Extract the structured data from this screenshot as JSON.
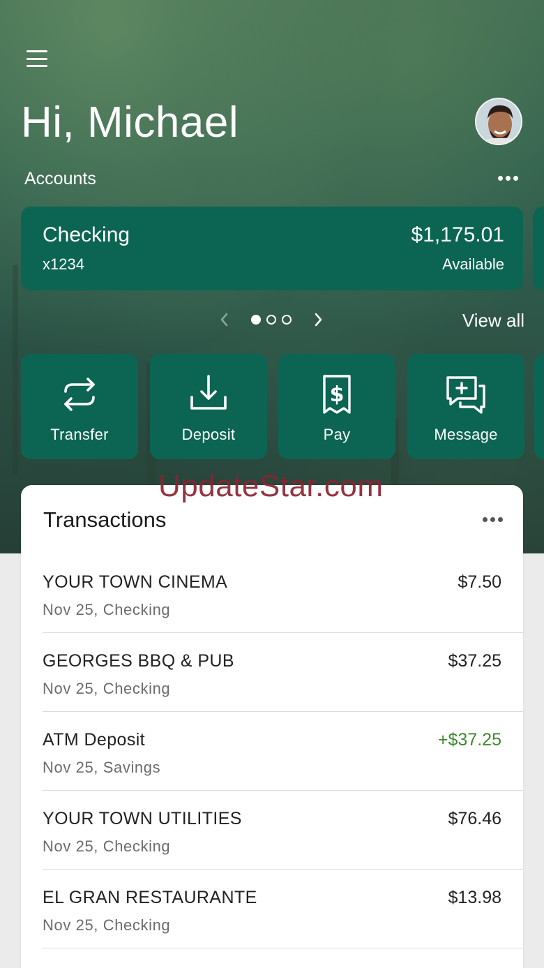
{
  "header": {
    "greeting": "Hi, Michael",
    "accounts_label": "Accounts"
  },
  "account": {
    "name": "Checking",
    "number": "x1234",
    "balance": "$1,175.01",
    "balance_label": "Available"
  },
  "carousel": {
    "page_count": 3,
    "active_page": 1,
    "view_all": "View all"
  },
  "actions": [
    {
      "label": "Transfer",
      "icon": "transfer-icon"
    },
    {
      "label": "Deposit",
      "icon": "deposit-icon"
    },
    {
      "label": "Pay",
      "icon": "pay-icon"
    },
    {
      "label": "Message",
      "icon": "message-icon"
    }
  ],
  "watermark": "UpdateStar.com",
  "transactions": {
    "title": "Transactions",
    "items": [
      {
        "name": "YOUR TOWN CINEMA",
        "sub": "Nov 25, Checking",
        "amount": "$7.50",
        "credit": false
      },
      {
        "name": "GEORGES BBQ & PUB",
        "sub": "Nov 25, Checking",
        "amount": "$37.25",
        "credit": false
      },
      {
        "name": "ATM Deposit",
        "sub": "Nov 25, Savings",
        "amount": "+$37.25",
        "credit": true
      },
      {
        "name": "YOUR TOWN UTILITIES",
        "sub": "Nov 25, Checking",
        "amount": "$76.46",
        "credit": false
      },
      {
        "name": "EL GRAN RESTAURANTE",
        "sub": "Nov 25, Checking",
        "amount": "$13.98",
        "credit": false
      }
    ]
  },
  "colors": {
    "card_green": "#0b6552",
    "credit_green": "#3b8a2c",
    "watermark_red": "#8b2330"
  }
}
